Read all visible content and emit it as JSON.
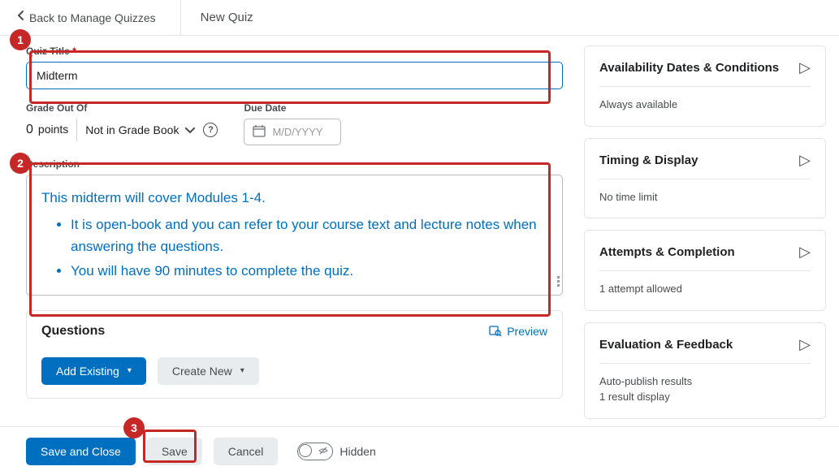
{
  "header": {
    "back_label": "Back to Manage Quizzes",
    "page_title": "New Quiz"
  },
  "form": {
    "title_label": "Quiz Title",
    "title_value": "Midterm",
    "grade_label": "Grade Out Of",
    "grade_points_value": "0",
    "grade_points_unit": "points",
    "grade_book_label": "Not in Grade Book",
    "due_date_label": "Due Date",
    "due_date_placeholder": "M/D/YYYY",
    "description_label": "Description",
    "description_intro": "This midterm will cover Modules 1-4.",
    "description_bullets": [
      "It is open-book and you can refer to your course text and lecture notes when answering the questions.",
      "You will have 90 minutes to complete the quiz."
    ]
  },
  "questions": {
    "heading": "Questions",
    "preview_label": "Preview",
    "add_existing_label": "Add Existing",
    "create_new_label": "Create New"
  },
  "side": {
    "panels": [
      {
        "title": "Availability Dates & Conditions",
        "body1": "Always available",
        "body2": ""
      },
      {
        "title": "Timing & Display",
        "body1": "No time limit",
        "body2": ""
      },
      {
        "title": "Attempts & Completion",
        "body1": "1 attempt allowed",
        "body2": ""
      },
      {
        "title": "Evaluation & Feedback",
        "body1": "Auto-publish results",
        "body2": "1 result display"
      }
    ]
  },
  "footer": {
    "save_close_label": "Save and Close",
    "save_label": "Save",
    "cancel_label": "Cancel",
    "visibility_label": "Hidden"
  },
  "annotations": {
    "b1": "1",
    "b2": "2",
    "b3": "3"
  }
}
